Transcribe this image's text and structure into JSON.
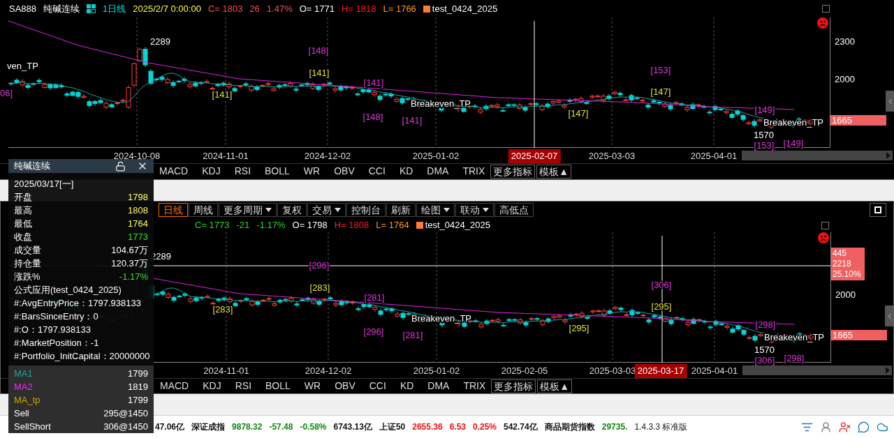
{
  "top_chart": {
    "header": {
      "symbol": "SA888",
      "name": "纯碱连续",
      "period": "1日线",
      "fields": [
        {
          "text": "2025/2/7 0:00:00",
          "color": "#ffff33"
        },
        {
          "text": "C= 1803",
          "color": "#ff4a4a"
        },
        {
          "text": "26",
          "color": "#ff4a4a"
        },
        {
          "text": "1.47%",
          "color": "#ff4a4a"
        },
        {
          "text": "O= 1771",
          "color": "#ffffff"
        },
        {
          "text": "H= 1818",
          "color": "#ff1a1a"
        },
        {
          "text": "L= 1766",
          "color": "#ff9a1a"
        }
      ],
      "strategy": "test_0424_2025"
    },
    "markers": [
      {
        "text": "2289",
        "color": "#ffffff"
      },
      {
        "text": "[148]",
        "color": "#e033e0"
      },
      {
        "text": "[141]",
        "color": "#e0e033"
      },
      {
        "text": "[141]",
        "color": "#e0e033"
      },
      {
        "text": "[141]",
        "color": "#e033e0"
      },
      {
        "text": "Breakeven_TP",
        "color": "#ffffff"
      },
      {
        "text": "[148]",
        "color": "#e033e0"
      },
      {
        "text": "[141]",
        "color": "#e033e0"
      },
      {
        "text": "[153]",
        "color": "#e033e0"
      },
      {
        "text": "[147]",
        "color": "#e0e033"
      },
      {
        "text": "[147]",
        "color": "#e0e033"
      },
      {
        "text": "[149]",
        "color": "#e033e0"
      },
      {
        "text": "1570",
        "color": "#ffffff"
      },
      {
        "text": "Breakeven_TP",
        "color": "#ffffff"
      },
      {
        "text": "[153]",
        "color": "#e033e0"
      },
      {
        "text": "[149]",
        "color": "#e033e0"
      },
      {
        "text": "ven_TP",
        "color": "#ffffff"
      },
      {
        "text": "06]",
        "color": "#e033e0"
      }
    ],
    "y_labels": [
      "2300",
      "2000"
    ],
    "price_badge": "1665",
    "x_labels": [
      {
        "text": "2024-10-08",
        "selected": false
      },
      {
        "text": "2024-11-01",
        "selected": false
      },
      {
        "text": "2024-12-02",
        "selected": false
      },
      {
        "text": "2025-01-02",
        "selected": false
      },
      {
        "text": "2025-02-07",
        "selected": true
      },
      {
        "text": "2025-03-03",
        "selected": false
      },
      {
        "text": "2025-04-01",
        "selected": false
      }
    ],
    "indicator_tabs": [
      {
        "label": "MACD",
        "kind": "tab"
      },
      {
        "label": "KDJ",
        "kind": "tab"
      },
      {
        "label": "RSI",
        "kind": "tab"
      },
      {
        "label": "BOLL",
        "kind": "tab"
      },
      {
        "label": "WR",
        "kind": "tab"
      },
      {
        "label": "OBV",
        "kind": "tab"
      },
      {
        "label": "CCI",
        "kind": "tab"
      },
      {
        "label": "KD",
        "kind": "tab"
      },
      {
        "label": "DMA",
        "kind": "tab"
      },
      {
        "label": "TRIX",
        "kind": "tab"
      },
      {
        "label": "更多指标",
        "kind": "button"
      },
      {
        "label": "模板▲",
        "kind": "button"
      }
    ]
  },
  "toolbar": [
    {
      "label": "日线",
      "selected": true,
      "dropdown": false
    },
    {
      "label": "周线",
      "selected": false,
      "dropdown": false
    },
    {
      "label": "更多周期",
      "selected": false,
      "dropdown": true
    },
    {
      "label": "复权",
      "selected": false,
      "dropdown": false
    },
    {
      "label": "交易",
      "selected": false,
      "dropdown": true
    },
    {
      "label": "控制台",
      "selected": false,
      "dropdown": false
    },
    {
      "label": "刷新",
      "selected": false,
      "dropdown": false
    },
    {
      "label": "绘图",
      "selected": false,
      "dropdown": true
    },
    {
      "label": "联动",
      "selected": false,
      "dropdown": true
    },
    {
      "label": "高低点",
      "selected": false,
      "dropdown": false
    }
  ],
  "bottom_chart": {
    "header": {
      "fields": [
        {
          "text": "C= 1773",
          "color": "#22dd22"
        },
        {
          "text": "-21",
          "color": "#22dd22"
        },
        {
          "text": "-1.17%",
          "color": "#22dd22"
        },
        {
          "text": "O= 1798",
          "color": "#ffffff"
        },
        {
          "text": "H= 1808",
          "color": "#ff1a1a"
        },
        {
          "text": "L= 1764",
          "color": "#ff9a1a"
        }
      ],
      "strategy": "test_0424_2025"
    },
    "markers": [
      {
        "text": "2289",
        "color": "#ffffff"
      },
      {
        "text": "[296]",
        "color": "#e033e0"
      },
      {
        "text": "[283]",
        "color": "#e0e033"
      },
      {
        "text": "[283]",
        "color": "#e0e033"
      },
      {
        "text": "[281]",
        "color": "#e033e0"
      },
      {
        "text": "Breakeven_TP",
        "color": "#ffffff"
      },
      {
        "text": "[296]",
        "color": "#e033e0"
      },
      {
        "text": "[281]",
        "color": "#e033e0"
      },
      {
        "text": "[306]",
        "color": "#e033e0"
      },
      {
        "text": "[295]",
        "color": "#e0e033"
      },
      {
        "text": "[295]",
        "color": "#e0e033"
      },
      {
        "text": "[298]",
        "color": "#e033e0"
      },
      {
        "text": "1570",
        "color": "#ffffff"
      },
      {
        "text": "Breakeven_TP",
        "color": "#ffffff"
      },
      {
        "text": "[306]",
        "color": "#e033e0"
      },
      {
        "text": "[298]",
        "color": "#e033e0"
      }
    ],
    "y_labels": [
      "2000"
    ],
    "crosshair_badge": [
      "445",
      "2218",
      "25.10%"
    ],
    "price_badge": "1665",
    "x_labels": [
      {
        "text": "2024-11-01",
        "selected": false
      },
      {
        "text": "2024-12-02",
        "selected": false
      },
      {
        "text": "2025-01-02",
        "selected": false
      },
      {
        "text": "2025-02-05",
        "selected": false
      },
      {
        "text": "2025-03-03",
        "selected": false
      },
      {
        "text": "2025-03-17",
        "selected": true
      },
      {
        "text": "2025-04-01",
        "selected": false
      }
    ],
    "indicator_tabs": [
      {
        "label": "MACD",
        "kind": "tab"
      },
      {
        "label": "KDJ",
        "kind": "tab"
      },
      {
        "label": "RSI",
        "kind": "tab"
      },
      {
        "label": "BOLL",
        "kind": "tab"
      },
      {
        "label": "WR",
        "kind": "tab"
      },
      {
        "label": "OBV",
        "kind": "tab"
      },
      {
        "label": "CCI",
        "kind": "tab"
      },
      {
        "label": "KD",
        "kind": "tab"
      },
      {
        "label": "DMA",
        "kind": "tab"
      },
      {
        "label": "TRIX",
        "kind": "tab"
      },
      {
        "label": "更多指标",
        "kind": "button"
      },
      {
        "label": "模板▲",
        "kind": "button"
      }
    ]
  },
  "data_window": {
    "title": "纯碱连续",
    "date": "2025/03/17[一]",
    "quotes": [
      {
        "label": "开盘",
        "value": "1798",
        "color": "#ffff66"
      },
      {
        "label": "最高",
        "value": "1808",
        "color": "#ffff66"
      },
      {
        "label": "最低",
        "value": "1764",
        "color": "#ffff66"
      },
      {
        "label": "收盘",
        "value": "1773",
        "color": "#33dd33"
      },
      {
        "label": "成交量",
        "value": "104.67万",
        "color": "#ffffff"
      },
      {
        "label": "持仓量",
        "value": "120.37万",
        "color": "#ffffff"
      },
      {
        "label": "涨跌%",
        "value": "-1.17%",
        "color": "#33dd33"
      }
    ],
    "formula_lines": [
      "公式应用(test_0424_2025)",
      "#:AvgEntryPrice：1797.938133",
      "#:BarsSinceEntry：0",
      "#:O：1797.938133",
      "#:MarketPosition：-1",
      "#:Portfolio_InitCapital：20000000"
    ],
    "series": [
      {
        "label": "MA1",
        "value": "1799",
        "color": "#20a0a0"
      },
      {
        "label": "MA2",
        "value": "1819",
        "color": "#ff22ff"
      },
      {
        "label": "MA_tp",
        "value": "1799",
        "color": "#c8a800"
      },
      {
        "label": "Sell",
        "value": "295@1450",
        "color": "#ffffff"
      },
      {
        "label": "SellShort",
        "value": "306@1450",
        "color": "#ffffff"
      }
    ]
  },
  "status_bar": {
    "items": [
      {
        "text": "47.06亿",
        "color": "#111111"
      },
      {
        "text": "深证成指",
        "color": "#111111"
      },
      {
        "text": "9878.32",
        "color": "#118811"
      },
      {
        "text": "-57.48",
        "color": "#118811"
      },
      {
        "text": "-0.58%",
        "color": "#118811"
      },
      {
        "text": "6743.13亿",
        "color": "#111111"
      },
      {
        "text": "上证50",
        "color": "#111111"
      },
      {
        "text": "2655.36",
        "color": "#ee1111"
      },
      {
        "text": "6.53",
        "color": "#ee1111"
      },
      {
        "text": "0.25%",
        "color": "#ee1111"
      },
      {
        "text": "542.74亿",
        "color": "#111111"
      },
      {
        "text": "商品期货指数",
        "color": "#111111"
      },
      {
        "text": "29735.",
        "color": "#118811"
      }
    ],
    "version": "1.4.3.3 标准版"
  }
}
